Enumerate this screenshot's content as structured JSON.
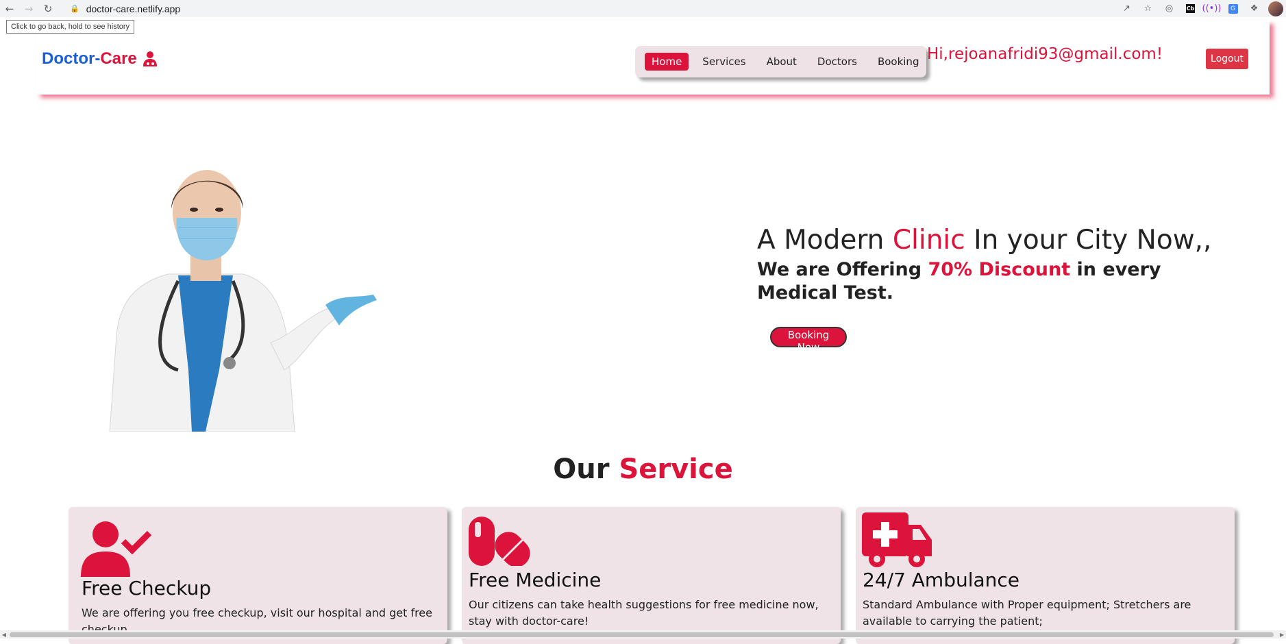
{
  "browser": {
    "url": "doctor-care.netlify.app",
    "tooltip": "Click to go back, hold to see history",
    "ext_cb": "Cb",
    "ext_g": "G"
  },
  "header": {
    "logo_part1": "Doctor-",
    "logo_part2": "Care",
    "nav": [
      "Home",
      "Services",
      "About",
      "Doctors",
      "Booking"
    ],
    "greeting": "Hi,rejoanafridi93@gmail.com!",
    "logout": "Logout"
  },
  "hero": {
    "title_pre": "A Modern ",
    "title_accent": "Clinic",
    "title_post": " In your City Now,,",
    "sub_pre": "We are Offering ",
    "sub_accent": "70% Discount",
    "sub_post": " in every Medical Test.",
    "button": "Booking Now"
  },
  "services": {
    "title_pre": "Our ",
    "title_accent": "Service",
    "cards": [
      {
        "icon": "user-check-icon",
        "title": "Free Checkup",
        "text": "We are offering you free checkup, visit our hospital and get free checkup."
      },
      {
        "icon": "pills-icon",
        "title": "Free Medicine",
        "text": "Our citizens can take health suggestions for free medicine now, stay with doctor-care!"
      },
      {
        "icon": "ambulance-icon",
        "title": "24/7 Ambulance",
        "text": "Standard Ambulance with Proper equipment; Stretchers are available to carrying the patient;"
      }
    ]
  },
  "colors": {
    "accent": "#dc143c",
    "logo_blue": "#1a5fd6",
    "card_bg": "#efe3e7",
    "logout_bg": "#dc3545"
  }
}
